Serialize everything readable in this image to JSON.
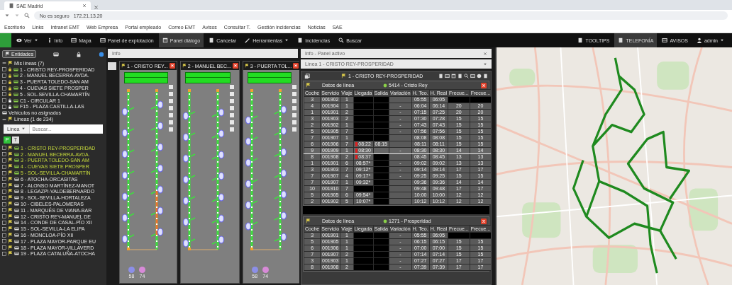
{
  "browser": {
    "tab_title": "SAE Madrid",
    "address_warning": "No es seguro",
    "url": "172.21.13.20",
    "bookmarks": [
      "Escritorio",
      "Links",
      "Intranet EMT",
      "Web Empresa",
      "Portal empleado",
      "Correo EMT",
      "Avisos",
      "Consultar T.",
      "Gestión incidencias",
      "Noticias",
      "SAE"
    ]
  },
  "navbar": {
    "items": [
      {
        "label": "Ver",
        "dropdown": true,
        "selected": false
      },
      {
        "label": "Info",
        "dropdown": false,
        "selected": false
      },
      {
        "label": "Mapa",
        "dropdown": false,
        "selected": false
      },
      {
        "label": "Panel de explotación",
        "dropdown": false,
        "selected": false
      },
      {
        "label": "Panel diálogo",
        "dropdown": false,
        "selected": true
      },
      {
        "label": "Cancelar",
        "dropdown": false,
        "selected": false
      },
      {
        "label": "Herramientas",
        "dropdown": true,
        "selected": false
      },
      {
        "label": "Incidencias",
        "dropdown": false,
        "selected": false
      },
      {
        "label": "Buscar",
        "dropdown": false,
        "selected": false
      }
    ],
    "right_items": [
      {
        "label": "TOOLTIPS",
        "dropdown": false,
        "selected": false
      },
      {
        "label": "TELEFONÍA",
        "dropdown": false,
        "selected": true
      },
      {
        "label": "AVISOS",
        "dropdown": false,
        "selected": false
      },
      {
        "label": "admin",
        "dropdown": true,
        "selected": false
      }
    ]
  },
  "sidebar": {
    "filter_button": "Entidades",
    "my_lines": {
      "label": "Mis líneas (7)",
      "expanded": true,
      "items": [
        {
          "label": "1 - CRISTO REY-PROSPERIDAD",
          "locked": true
        },
        {
          "label": "2 - MANUEL BECERRA-AVDA.",
          "locked": true
        },
        {
          "label": "3 - PUERTA TOLEDO-SAN AM",
          "locked": true
        },
        {
          "label": "4 - CUEVAS SIETE PROSPER",
          "locked": true
        },
        {
          "label": "5 - SOL-SEVILLA-CHAMARTÍN",
          "locked": true
        },
        {
          "label": "C1 - CIRCULAR 1",
          "locked": false
        },
        {
          "label": "F15 - PLAZA CASTILLA-LAS",
          "locked": false
        }
      ]
    },
    "unassigned": "Vehículos no asignados",
    "lines": {
      "label": "Líneas (1 de 234)",
      "expanded": true,
      "search_select": "Línea",
      "search_placeholder": "Buscar...",
      "toggles": [
        {
          "label": "P",
          "selected": true
        },
        {
          "label": "T",
          "selected": false
        }
      ],
      "items": [
        {
          "label": "1 - CRISTO REY-PROSPERIDAD",
          "active": true
        },
        {
          "label": "2 - MANUEL BECERRA-AVDA.",
          "active": true
        },
        {
          "label": "3 - PUERTA TOLEDO-SAN AM",
          "active": true
        },
        {
          "label": "4 - CUEVAS SIETE PROSPER",
          "active": true
        },
        {
          "label": "5 - SOL-SEVILLA-CHAMARTÍN",
          "active": true
        },
        {
          "label": "6 - ATOCHA-ORCASITAS",
          "active": false
        },
        {
          "label": "7 - ALONSO MARTÍNEZ-MANOT",
          "active": false
        },
        {
          "label": "8 - LEGAZPI-VALDEBERNARDO",
          "active": false
        },
        {
          "label": "9 - SOL-SEVILLA-HORTALEZA",
          "active": false
        },
        {
          "label": "10 - CIBELES-PALOMERAS",
          "active": false
        },
        {
          "label": "11 - MARQUÉS DE VIANA-BAR",
          "active": false
        },
        {
          "label": "12 - CRISTO REY-MANUEL DE",
          "active": false
        },
        {
          "label": "14 - CONDE DE CASAL-PÍO XII",
          "active": false
        },
        {
          "label": "15 - SOL-SEVILLA-LA ELIPA",
          "active": false
        },
        {
          "label": "16 - MONCLOA-PÍO XII",
          "active": false
        },
        {
          "label": "17 - PLAZA MAYOR-PARQUE EU",
          "active": false
        },
        {
          "label": "18 - PLAZA MAYOR-VILLAVERD",
          "active": false
        },
        {
          "label": "19 - PLAZA CATALUÑA-ATOCHA",
          "active": false
        }
      ]
    }
  },
  "schematic": {
    "header": "Info",
    "panels": [
      {
        "title": "1 - CRISTO REY...",
        "legend": [
          {
            "label": "58",
            "color": "#8c8fe8"
          },
          {
            "label": "74",
            "color": "#d88ad8"
          }
        ]
      },
      {
        "title": "2 - MANUEL BEC..."
      },
      {
        "title": "3 - PUERTA TOL...",
        "legend": [
          {
            "label": "58",
            "color": "#8c8fe8"
          },
          {
            "label": "74",
            "color": "#d88ad8"
          }
        ]
      }
    ]
  },
  "detail": {
    "header": "Info - Panel activo",
    "line_select": "Línea 1 - CRISTO REY-PROSPERIDAD",
    "title": "1 - CRISTO REY-PROSPERIDAD",
    "groups": [
      {
        "label": "Datos de línea",
        "terminal": "5414 - Cristo Rey",
        "columns": [
          "Coche",
          "Servicio",
          "Viaje",
          "Llegada",
          "Salida",
          "Variación",
          "H. Teo.",
          "H. Real",
          "Frecue...",
          "Frecue..."
        ],
        "rows": [
          {
            "cells": [
              "3",
              "001902",
              "1",
              "",
              "",
              "",
              "05:55",
              "06:05",
              "",
              ""
            ],
            "selected": false,
            "alert": false
          },
          {
            "cells": [
              "4",
              "001904",
              "1",
              "",
              "",
              "-",
              "06:04",
              "06:14",
              "20",
              "20"
            ],
            "selected": false,
            "alert": false
          },
          {
            "cells": [
              "1",
              "001901",
              "2",
              "",
              "",
              "-",
              "07:15",
              "07:25",
              "20",
              "20"
            ],
            "selected": false,
            "alert": false
          },
          {
            "cells": [
              "3",
              "001903",
              "2",
              "",
              "",
              "-",
              "07:30",
              "07:28",
              "15",
              "15"
            ],
            "selected": false,
            "alert": false
          },
          {
            "cells": [
              "2",
              "001902",
              "1",
              "",
              "",
              "-",
              "07:43",
              "07:43",
              "15",
              "15"
            ],
            "selected": false,
            "alert": false
          },
          {
            "cells": [
              "5",
              "001905",
              "7",
              "",
              "",
              "-",
              "07:56",
              "07:56",
              "15",
              "15"
            ],
            "selected": false,
            "alert": false
          },
          {
            "cells": [
              "7",
              "001907",
              "1",
              "",
              "",
              "",
              "08:08",
              "08:08",
              "15",
              "15"
            ],
            "selected": false,
            "alert": false
          },
          {
            "cells": [
              "6",
              "001906",
              "7",
              "08:22",
              "08:15",
              "",
              "08:11",
              "08:11",
              "15",
              "15"
            ],
            "selected": false,
            "alert": true
          },
          {
            "cells": [
              "9",
              "001909",
              "1",
              "08:30",
              "",
              "-",
              "08:30",
              "08:30",
              "14",
              "14"
            ],
            "selected": true,
            "alert": true
          },
          {
            "cells": [
              "8",
              "001908",
              "2",
              "08:37",
              "",
              "",
              "08:45",
              "08:45",
              "13",
              "13"
            ],
            "selected": false,
            "alert": true
          },
          {
            "cells": [
              "1",
              "001901",
              "6",
              "08:57*",
              "",
              "-",
              "09:02",
              "09:02",
              "13",
              "13"
            ],
            "selected": false,
            "alert": false
          },
          {
            "cells": [
              "3",
              "001903",
              "7",
              "09:12*",
              "",
              "-",
              "09:14",
              "09:14",
              "17",
              "17"
            ],
            "selected": false,
            "alert": false
          },
          {
            "cells": [
              "7",
              "001907",
              "4",
              "09:17*",
              "",
              "-",
              "09:25",
              "09:25",
              "15",
              "15"
            ],
            "selected": false,
            "alert": false
          },
          {
            "cells": [
              "7",
              "001907",
              "1",
              "09:32*",
              "",
              "",
              "09:36",
              "09:36",
              "14",
              "14"
            ],
            "selected": false,
            "alert": false
          },
          {
            "cells": [
              "10",
              "001910",
              "7",
              "",
              "",
              "",
              "09:48",
              "09:48",
              "17",
              "17"
            ],
            "selected": false,
            "alert": false
          },
          {
            "cells": [
              "5",
              "001905",
              "6",
              "09:54*",
              "",
              "",
              "10:00",
              "10:00",
              "12",
              "12"
            ],
            "selected": false,
            "alert": false
          },
          {
            "cells": [
              "2",
              "001902",
              "5",
              "10:07*",
              "",
              "",
              "10:12",
              "10:12",
              "12",
              "12"
            ],
            "selected": false,
            "alert": false
          }
        ]
      },
      {
        "label": "Datos de línea",
        "terminal": "1271 - Prosperidad",
        "columns": [
          "Coche",
          "Servicio",
          "Viaje",
          "Llegada",
          "Salida",
          "Variación",
          "H. Teo.",
          "H. Real",
          "Frecue...",
          "Frecue..."
        ],
        "rows": [
          {
            "cells": [
              "3",
              "001901",
              "1",
              "",
              "",
              "-",
              "05:55",
              "06:05",
              "",
              ""
            ],
            "selected": false,
            "alert": false
          },
          {
            "cells": [
              "5",
              "001905",
              "1",
              "",
              "",
              "-",
              "06:15",
              "06:15",
              "15",
              "15"
            ],
            "selected": false,
            "alert": false
          },
          {
            "cells": [
              "6",
              "001906",
              "1",
              "",
              "",
              "-",
              "07:00",
              "07:00",
              "15",
              "15"
            ],
            "selected": false,
            "alert": false
          },
          {
            "cells": [
              "7",
              "001907",
              "2",
              "",
              "",
              "-",
              "07:14",
              "07:14",
              "15",
              "15"
            ],
            "selected": false,
            "alert": false
          },
          {
            "cells": [
              "3",
              "001903",
              "1",
              "",
              "",
              "-",
              "07:27",
              "07:27",
              "17",
              "17"
            ],
            "selected": false,
            "alert": false
          },
          {
            "cells": [
              "8",
              "001908",
              "2",
              "",
              "",
              "-",
              "07:39",
              "07:39",
              "17",
              "17"
            ],
            "selected": false,
            "alert": false
          }
        ]
      }
    ]
  }
}
